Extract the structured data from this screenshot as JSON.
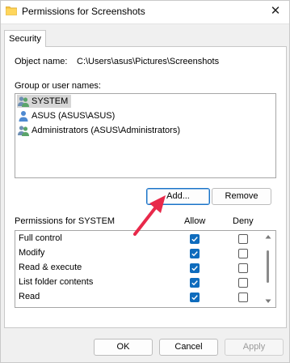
{
  "window": {
    "title": "Permissions for Screenshots",
    "close_glyph": "✕"
  },
  "tabs": [
    {
      "label": "Security",
      "active": true
    }
  ],
  "object": {
    "label": "Object name:",
    "value": "C:\\Users\\asus\\Pictures\\Screenshots"
  },
  "groups": {
    "label": "Group or user names:",
    "items": [
      {
        "name": "SYSTEM",
        "icon": "user-group-icon",
        "selected": true
      },
      {
        "name": "ASUS (ASUS\\ASUS)",
        "icon": "user-icon",
        "selected": false
      },
      {
        "name": "Administrators (ASUS\\Administrators)",
        "icon": "user-group-icon",
        "selected": false
      }
    ],
    "add_label": "Add...",
    "remove_label": "Remove"
  },
  "permissions": {
    "label": "Permissions for SYSTEM",
    "allow_header": "Allow",
    "deny_header": "Deny",
    "rows": [
      {
        "name": "Full control",
        "allow": true,
        "deny": false
      },
      {
        "name": "Modify",
        "allow": true,
        "deny": false
      },
      {
        "name": "Read & execute",
        "allow": true,
        "deny": false
      },
      {
        "name": "List folder contents",
        "allow": true,
        "deny": false
      },
      {
        "name": "Read",
        "allow": true,
        "deny": false
      },
      {
        "name": "",
        "allow": true,
        "deny": false
      }
    ]
  },
  "footer": {
    "ok_label": "OK",
    "cancel_label": "Cancel",
    "apply_label": "Apply"
  },
  "colors": {
    "checkbox_checked": "#0f6cbd",
    "arrow": "#e8294a",
    "selected_row": "#d6d6d6"
  }
}
